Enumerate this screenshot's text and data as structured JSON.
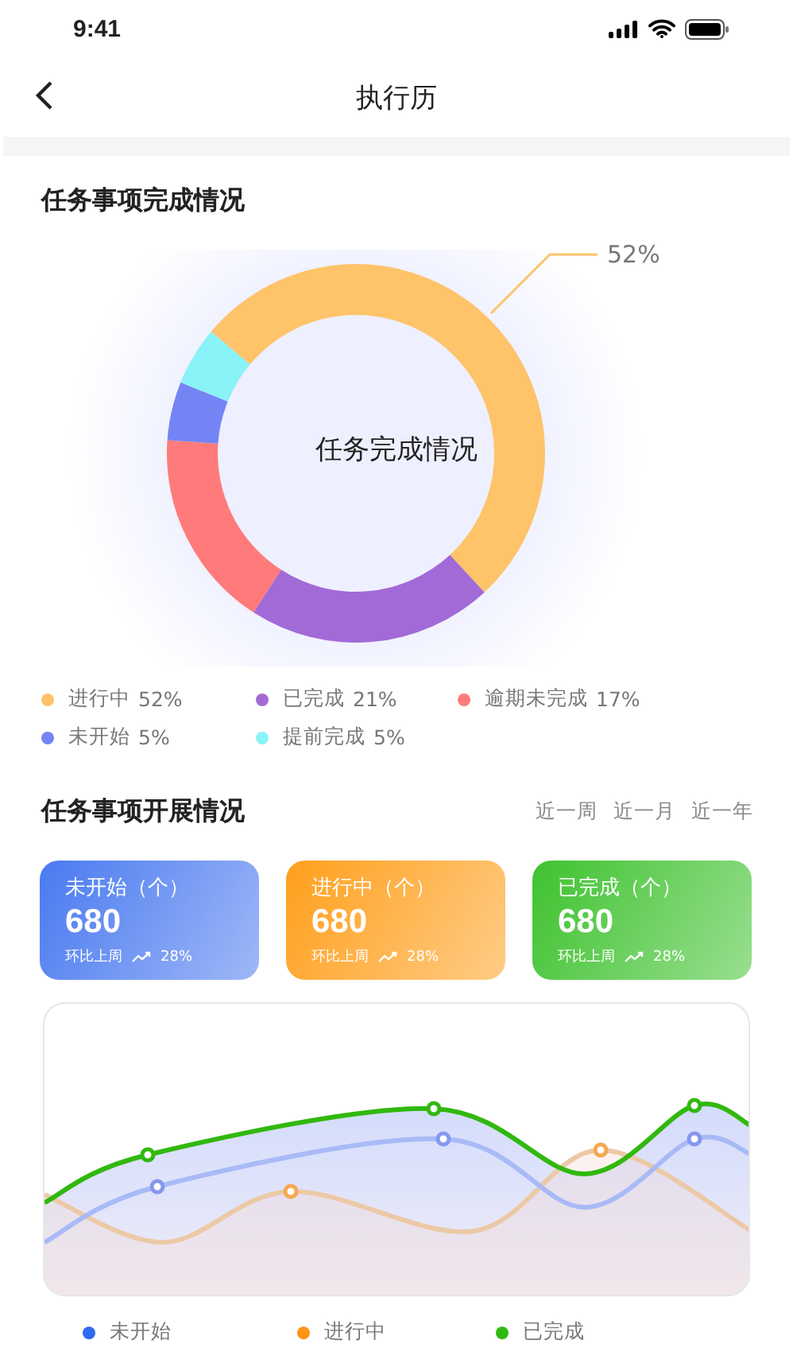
{
  "status_bar": {
    "time": "9:41"
  },
  "nav": {
    "title": "执行历"
  },
  "completion": {
    "title": "任务事项完成情况",
    "callout": "52%",
    "chart_data": {
      "type": "donut",
      "title": "任务完成情况",
      "categories": [
        "进行中",
        "已完成",
        "逾期未完成",
        "未开始",
        "提前完成"
      ],
      "values": [
        52,
        21,
        17,
        5,
        5
      ],
      "value_labels": [
        "52%",
        "21%",
        "17%",
        "5%",
        "5%"
      ]
    },
    "legend": [
      {
        "color": "#ffc36a"
      },
      {
        "color": "#a26ad6"
      },
      {
        "color": "#ff7b7b"
      },
      {
        "color": "#7584f5"
      },
      {
        "color": "#8af3f7"
      }
    ]
  },
  "progress": {
    "title": "任务事项开展情况",
    "periods": [
      {
        "label": "近一周",
        "selected": false
      },
      {
        "label": "近一月",
        "selected": false
      },
      {
        "label": "近一年",
        "selected": false
      }
    ],
    "cards": [
      {
        "title": "未开始（个）",
        "value": "680",
        "compare": "环比上周",
        "change": "28%",
        "color": "#4a7af0"
      },
      {
        "title": "进行中（个）",
        "value": "680",
        "compare": "环比上周",
        "change": "28%",
        "color": "#ff9f1c"
      },
      {
        "title": "已完成（个）",
        "value": "680",
        "compare": "环比上周",
        "change": "28%",
        "color": "#3fc22f"
      }
    ],
    "legend": [
      {
        "label": "未开始",
        "color": "#2f6bf0"
      },
      {
        "label": "进行中",
        "color": "#ff9416"
      },
      {
        "label": "已完成",
        "color": "#2fb90f"
      }
    ]
  }
}
